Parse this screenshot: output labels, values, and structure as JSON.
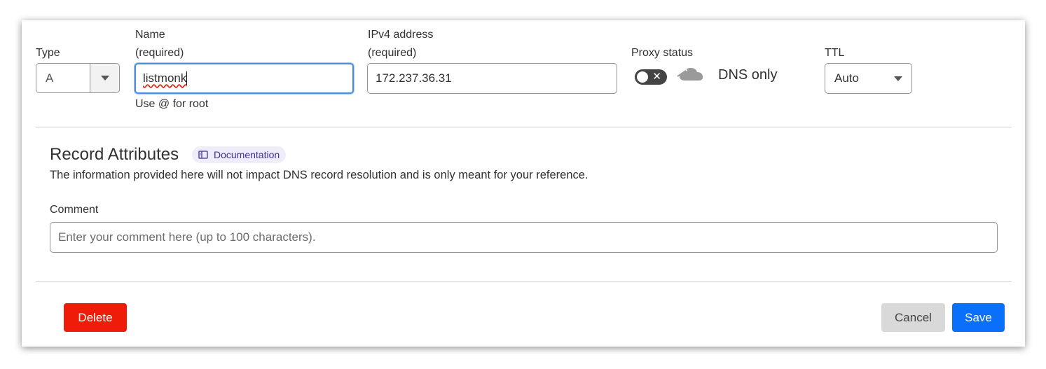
{
  "fields": {
    "type": {
      "label": "Type",
      "value": "A"
    },
    "name": {
      "label": "Name",
      "required": "(required)",
      "value": "listmonk",
      "help": "Use @ for root"
    },
    "ipv4": {
      "label": "IPv4 address",
      "required": "(required)",
      "value": "172.237.36.31"
    },
    "proxy": {
      "label": "Proxy status",
      "status_text": "DNS only",
      "enabled": false
    },
    "ttl": {
      "label": "TTL",
      "value": "Auto"
    }
  },
  "attributes": {
    "title": "Record Attributes",
    "doc_link": "Documentation",
    "description": "The information provided here will not impact DNS record resolution and is only meant for your reference.",
    "comment_label": "Comment",
    "comment_placeholder": "Enter your comment here (up to 100 characters)."
  },
  "actions": {
    "delete": "Delete",
    "cancel": "Cancel",
    "save": "Save"
  },
  "colors": {
    "delete": "#ee1c09",
    "save": "#0a6ffb",
    "cancel": "#d9d9d9",
    "focus": "#4b8de0",
    "doc_badge_bg": "#efedf9"
  },
  "icons": {
    "type_caret": "chevron-down-icon",
    "ttl_caret": "chevron-down-icon",
    "proxy": "cloud-dns-only-icon",
    "doc": "book-icon",
    "toggle_off": "close-icon"
  }
}
